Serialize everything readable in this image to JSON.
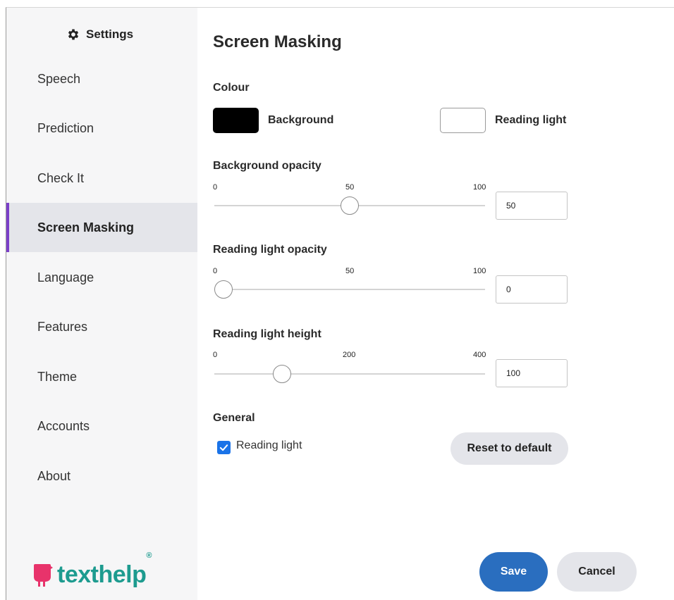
{
  "sidebar": {
    "title": "Settings",
    "title_icon": "gear-icon",
    "items": [
      {
        "label": "Speech"
      },
      {
        "label": "Prediction"
      },
      {
        "label": "Check It"
      },
      {
        "label": "Screen Masking",
        "active": true
      },
      {
        "label": "Language"
      },
      {
        "label": "Features"
      },
      {
        "label": "Theme"
      },
      {
        "label": "Accounts"
      },
      {
        "label": "About"
      }
    ],
    "logo_text": "texthelp",
    "logo_mark": "®",
    "logo_color": "#1d9b8f",
    "accent_color": "#7b3fc9"
  },
  "main": {
    "title": "Screen Masking",
    "colour": {
      "heading": "Colour",
      "background_label": "Background",
      "background_color": "#000000",
      "reading_light_label": "Reading light",
      "reading_light_color": "#ffffff"
    },
    "background_opacity": {
      "heading": "Background opacity",
      "ticks": [
        "0",
        "50",
        "100"
      ],
      "min": 0,
      "max": 100,
      "value": 50,
      "value_text": "50"
    },
    "reading_light_opacity": {
      "heading": "Reading light opacity",
      "ticks": [
        "0",
        "50",
        "100"
      ],
      "min": 0,
      "max": 100,
      "value": 0,
      "value_text": "0"
    },
    "reading_light_height": {
      "heading": "Reading light height",
      "ticks": [
        "0",
        "200",
        "400"
      ],
      "min": 0,
      "max": 400,
      "value": 100,
      "value_text": "100"
    },
    "general": {
      "heading": "General",
      "reading_light_checkbox_label": "Reading light",
      "reading_light_checked": true,
      "reset_label": "Reset to default"
    },
    "footer": {
      "save_label": "Save",
      "cancel_label": "Cancel",
      "save_color": "#2a6ebf"
    }
  }
}
